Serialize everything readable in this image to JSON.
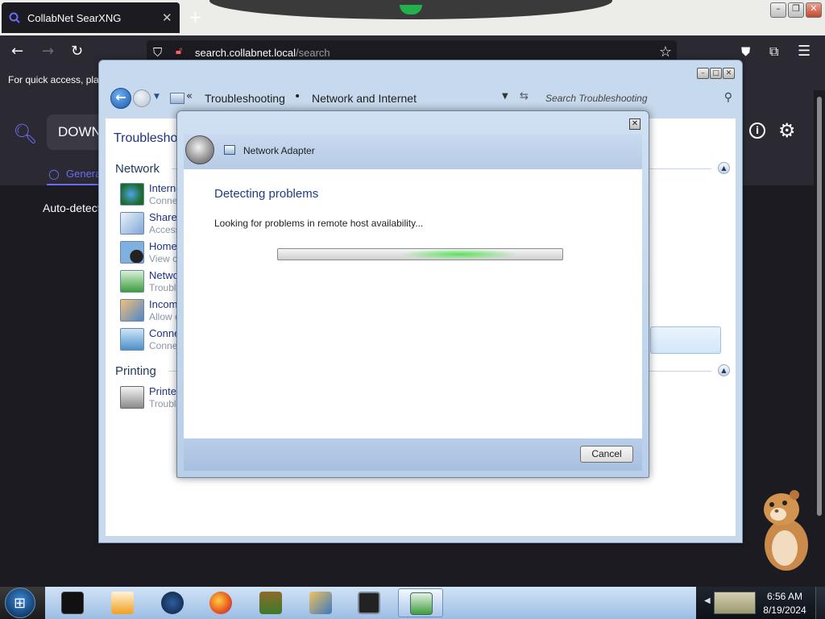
{
  "browser": {
    "tab_title": "CollabNet SearXNG",
    "tab_close": "✕",
    "new_tab": "+",
    "url_host": "search.collabnet.local",
    "url_path": "/search",
    "bookmarks_text": "For quick access, place your bookmarks here",
    "colors": {
      "tab_bg": "#1c1b22",
      "toolbar_bg": "#2b2a33",
      "accent": "#6a6cf7"
    }
  },
  "searx": {
    "query": "DOWN",
    "category": "General",
    "auto_detect": "Auto-detect"
  },
  "control_panel": {
    "breadcrumb": [
      "Troubleshooting",
      "Network and Internet"
    ],
    "search_placeholder": "Search Troubleshooting",
    "heading": "Troubleshoot",
    "sections": [
      {
        "title": "Network",
        "items": [
          {
            "title": "Internet Connections",
            "subtitle": "Connect to the Internet",
            "icon": "globe-network-icon"
          },
          {
            "title": "Shared Folders",
            "subtitle": "Access shared files",
            "icon": "shared-folder-icon"
          },
          {
            "title": "HomeGroup",
            "subtitle": "View computers",
            "icon": "homegroup-icon"
          },
          {
            "title": "Network Adapter",
            "subtitle": "Troubleshoot",
            "icon": "network-adapter-icon"
          },
          {
            "title": "Incoming Connections",
            "subtitle": "Allow other computers",
            "icon": "incoming-connections-icon"
          },
          {
            "title": "Connection to a Workplace",
            "subtitle": "Connect to your workplace",
            "icon": "workplace-connection-icon"
          }
        ]
      },
      {
        "title": "Printing",
        "items": [
          {
            "title": "Printer",
            "subtitle": "Troubleshoot",
            "icon": "printer-icon"
          }
        ]
      }
    ]
  },
  "dialog": {
    "header_title": "Network Adapter",
    "title": "Detecting problems",
    "status": "Looking for problems in remote host availability...",
    "cancel_label": "Cancel"
  },
  "taskbar": {
    "apps": [
      "terminal",
      "media-player",
      "globe",
      "firefox",
      "box-game",
      "network-tool",
      "monitor",
      "network-troubleshooter"
    ],
    "active_app": "network-troubleshooter",
    "time": "6:56 AM",
    "date": "8/19/2024"
  }
}
